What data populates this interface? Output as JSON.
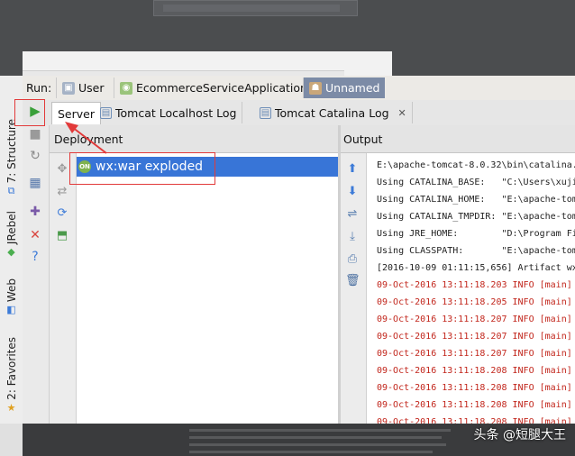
{
  "tool_windows": {
    "structure": "7: Structure",
    "jrebel": "JRebel",
    "web": "Web",
    "favorites": "2: Favorites"
  },
  "run": {
    "label": "Run:",
    "configs": [
      {
        "label": "User",
        "icon": "user-icon",
        "active": false
      },
      {
        "label": "EcommerceServiceApplication",
        "icon": "spring-boot-icon",
        "active": false
      },
      {
        "label": "Unnamed",
        "icon": "tomcat-icon",
        "active": true
      }
    ]
  },
  "sub_tabs": [
    {
      "label": "Server",
      "active": true
    },
    {
      "label": "Tomcat Localhost Log",
      "active": false
    },
    {
      "label": "Tomcat Catalina Log",
      "active": false
    }
  ],
  "deployment": {
    "header": "Deployment",
    "item": "wx:war exploded",
    "item_badge": "ON"
  },
  "output": {
    "header": "Output",
    "lines": [
      {
        "text": "E:\\apache-tomcat-8.0.32\\bin\\catalina.",
        "kind": "sys"
      },
      {
        "text": "Using CATALINA_BASE:   \"C:\\Users\\xuji",
        "kind": "sys"
      },
      {
        "text": "Using CATALINA_HOME:   \"E:\\apache-tom",
        "kind": "sys"
      },
      {
        "text": "Using CATALINA_TMPDIR: \"E:\\apache-tom",
        "kind": "sys"
      },
      {
        "text": "Using JRE_HOME:        \"D:\\Program Fi",
        "kind": "sys"
      },
      {
        "text": "Using CLASSPATH:       \"E:\\apache-tom",
        "kind": "sys"
      },
      {
        "text": "[2016-10-09 01:11:15,656] Artifact wx",
        "kind": "sys"
      },
      {
        "text": "09-Oct-2016 13:11:18.203 INFO [main]",
        "kind": "red"
      },
      {
        "text": "09-Oct-2016 13:11:18.205 INFO [main]",
        "kind": "red"
      },
      {
        "text": "09-Oct-2016 13:11:18.207 INFO [main]",
        "kind": "red"
      },
      {
        "text": "09-Oct-2016 13:11:18.207 INFO [main]",
        "kind": "red"
      },
      {
        "text": "09-Oct-2016 13:11:18.207 INFO [main]",
        "kind": "red"
      },
      {
        "text": "09-Oct-2016 13:11:18.208 INFO [main]",
        "kind": "red"
      },
      {
        "text": "09-Oct-2016 13:11:18.208 INFO [main]",
        "kind": "red"
      },
      {
        "text": "09-Oct-2016 13:11:18.208 INFO [main]",
        "kind": "red"
      },
      {
        "text": "09-Oct-2016 13:11:18.208 INFO [main]",
        "kind": "red"
      }
    ]
  },
  "watermark": "头条 @短腿大王",
  "colors": {
    "selection": "#3875d7",
    "active_config": "#7c8ba6",
    "annotation_red": "#e23a3a",
    "log_red": "#c2261c",
    "run_green": "#3aa03a"
  }
}
